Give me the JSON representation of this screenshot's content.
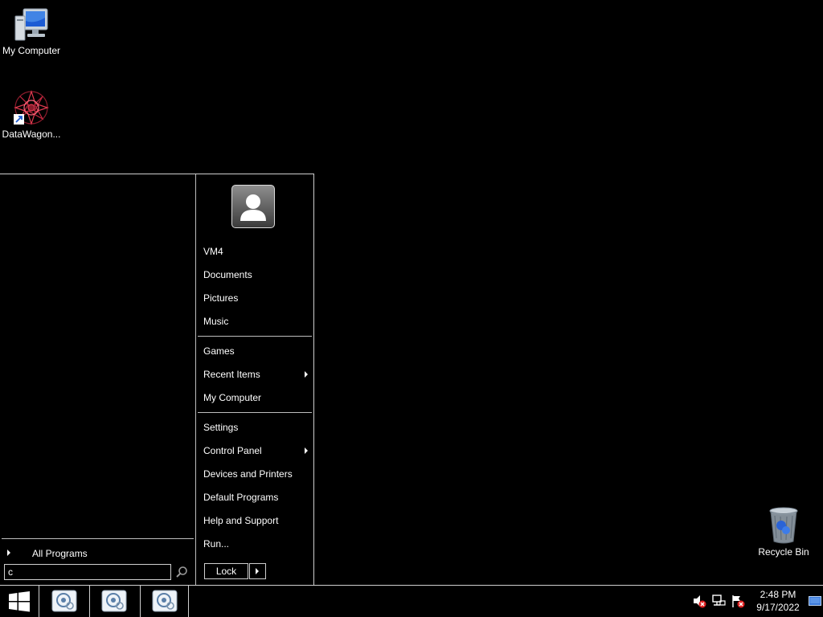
{
  "desktop": {
    "icons": [
      {
        "label": "My Computer",
        "icon": "my-computer-icon"
      },
      {
        "label": "DataWagon...",
        "icon": "datawagon-icon"
      },
      {
        "label": "Recycle Bin",
        "icon": "recycle-bin-icon"
      }
    ]
  },
  "start_menu": {
    "all_programs": "All Programs",
    "search": {
      "value": "c",
      "placeholder": ""
    },
    "right_items": [
      {
        "label": "VM4"
      },
      {
        "label": "Documents"
      },
      {
        "label": "Pictures"
      },
      {
        "label": "Music"
      },
      {
        "label": "Games"
      },
      {
        "label": "Recent Items",
        "submenu": true
      },
      {
        "label": "My Computer"
      },
      {
        "label": "Settings"
      },
      {
        "label": "Control Panel",
        "submenu": true
      },
      {
        "label": "Devices and Printers"
      },
      {
        "label": "Default Programs"
      },
      {
        "label": "Help and Support"
      },
      {
        "label": "Run..."
      }
    ],
    "lock_label": "Lock"
  },
  "taskbar": {
    "task_buttons": [
      "task-icon",
      "task-icon",
      "task-icon"
    ],
    "tray": [
      "volume-muted-icon",
      "network-icon",
      "action-center-flag-icon"
    ],
    "clock": {
      "time": "2:48 PM",
      "date": "9/17/2022"
    }
  },
  "colors": {
    "background": "#000000",
    "border": "#cfcfcf",
    "text": "#ffffff"
  }
}
